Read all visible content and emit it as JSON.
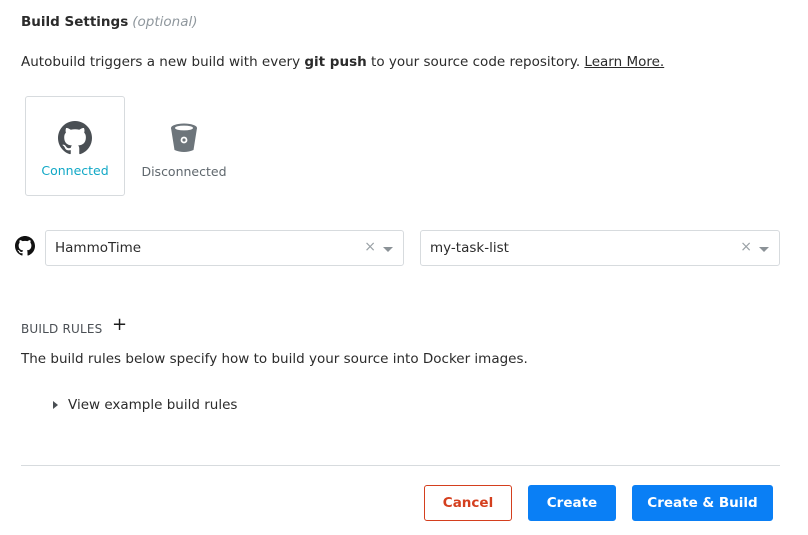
{
  "build_settings": {
    "title": "Build Settings",
    "optional_label": "(optional)",
    "description": {
      "prefix": "Autobuild triggers a new build with every ",
      "bold": "git push",
      "suffix": " to your source code repository. ",
      "link": "Learn More."
    }
  },
  "sources": [
    {
      "icon": "github-icon",
      "label": "Connected",
      "color": "#11a8c6"
    },
    {
      "icon": "bitbucket-icon",
      "label": "Disconnected",
      "color": "#5f676d"
    }
  ],
  "repo_selector": {
    "source_icon": "github-icon",
    "organization": {
      "value": "HammoTime",
      "clear_icon": "×"
    },
    "repository": {
      "value": "my-task-list",
      "clear_icon": "×"
    }
  },
  "build_rules": {
    "heading": "BUILD RULES",
    "add_icon": "+",
    "description": "The build rules below specify how to build your source into Docker images.",
    "example_toggle": "View example build rules"
  },
  "actions": {
    "cancel": "Cancel",
    "create": "Create",
    "create_and_build": "Create & Build"
  },
  "colors": {
    "primary": "#0a7ff5",
    "danger": "#d43f1e",
    "connected": "#11a8c6",
    "border": "#d7dbde"
  }
}
